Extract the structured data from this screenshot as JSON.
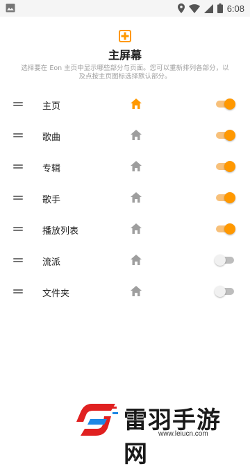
{
  "status_bar": {
    "time": "6:08",
    "icons": [
      "image-icon",
      "location-icon",
      "wifi-icon",
      "signal-icon",
      "battery-icon"
    ]
  },
  "header": {
    "icon": "home-screen-icon",
    "title": "主屏幕",
    "description": "选择要在 Eon 主页中显示哪些部分与页面。您可以重新排列各部分，以及点按主页图标选择默认部分。"
  },
  "sections": [
    {
      "label": "主页",
      "home_default": true,
      "enabled": true
    },
    {
      "label": "歌曲",
      "home_default": false,
      "enabled": true
    },
    {
      "label": "专辑",
      "home_default": false,
      "enabled": true
    },
    {
      "label": "歌手",
      "home_default": false,
      "enabled": true
    },
    {
      "label": "播放列表",
      "home_default": false,
      "enabled": true
    },
    {
      "label": "流派",
      "home_default": false,
      "enabled": false
    },
    {
      "label": "文件夹",
      "home_default": false,
      "enabled": false
    }
  ],
  "watermark": {
    "name": "雷羽手游网",
    "url": "www.leiucn.com"
  },
  "colors": {
    "accent": "#ff9800",
    "track_on": "#f7c07a",
    "icon_inactive": "#9e9e9e",
    "text_secondary": "#9e9e9e"
  }
}
